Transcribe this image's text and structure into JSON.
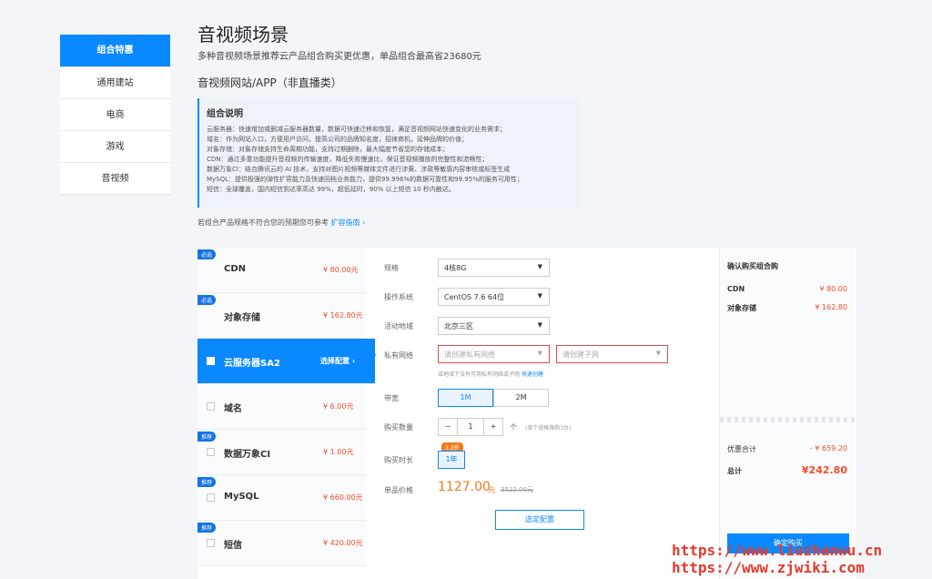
{
  "sidebar": {
    "items": [
      "组合特惠",
      "通用建站",
      "电商",
      "游戏",
      "音视频"
    ]
  },
  "header": {
    "title": "音视频场景",
    "subtitle": "多种音视频场景推荐云产品组合购买更优惠，单品组合最高省23680元",
    "section": "音视频网站/APP（非直播类）"
  },
  "desc": {
    "heading": "组合说明",
    "lines": [
      "云服务器：快速增加或删减云服务器数量，数据可快速迁移和恢复，满足音视频网站快速变化的业务需求；",
      "域名：作为网站入口，方便用户访问，提高公司的品牌知名度，招徕商机，延伸品牌的价值；",
      "对象存储：对象存储支持生命周期功能，支持过期删除，最大幅度节省您的存储成本；",
      "CDN：通过多重功能提升音视频的传输速度，降低失败慢速比，保证音视频播放的完整性和流畅性；",
      "数据万象CI：结合腾讯云的 AI 技术，支持对图片视频等媒体文件进行涉黄、涉政等敏感内容审核或标签生成",
      "MySQL：提供极强的弹性扩容能力及快速回档业务能力，提供99.996%的数据可靠性和99.95%的服务可用性；",
      "短信：全球覆盖，国内短信到达率高达 99%，超低延时，90% 以上短信 10 秒内触达。"
    ]
  },
  "hint": {
    "text": "若组合产品规格不符合您的预期您可参考",
    "link": "扩容指南 ›"
  },
  "products": [
    {
      "tag": "必选",
      "name": "CDN",
      "price": "¥ 80.00元"
    },
    {
      "tag": "必选",
      "name": "对象存储",
      "price": "¥ 162.80元"
    },
    {
      "tag": "",
      "name": "云服务器SA2",
      "select": "选择配置 ›"
    },
    {
      "tag": "",
      "name": "域名",
      "price": "¥ 6.00元"
    },
    {
      "tag": "推荐",
      "name": "数据万象CI",
      "price": "¥ 1.00元"
    },
    {
      "tag": "推荐",
      "name": "MySQL",
      "price": "¥ 660.00元"
    },
    {
      "tag": "推荐",
      "name": "短信",
      "price": "¥ 420.00元"
    }
  ],
  "form": {
    "spec_label": "规格",
    "spec": "4核8G",
    "os_label": "操作系统",
    "os": "CentOS 7.6 64位",
    "region_label": "活动地域",
    "region": "北京三区",
    "net_label": "私有网络",
    "vpc": "请创建私有网络",
    "subnet": "请创建子网",
    "net_note": "该地域下没有可用私有网络或子网",
    "net_link": "快速创建",
    "bw_label": "带宽",
    "bw1": "1M",
    "bw2": "2M",
    "qty_label": "购买数量",
    "qty": "1",
    "qty_unit": "个",
    "qty_note": "(单个规格限购3台)",
    "dur_label": "购买时长",
    "dur_badge": "3.2折",
    "dur": "1年",
    "price_label": "单品价格",
    "price": "1127.00",
    "price_unit": "元",
    "orig": "3522.00元",
    "confirm_btn": "选定配置",
    "minus": "−",
    "plus": "+"
  },
  "cart": {
    "title": "确认购买组合购",
    "items": [
      {
        "name": "CDN",
        "price": "¥ 80.00"
      },
      {
        "name": "对象存储",
        "price": "¥ 162.80"
      }
    ],
    "discount_label": "优惠合计",
    "discount": "- ¥ 659.20",
    "total_label": "总计",
    "total": "¥242.80",
    "buy": "确定购买"
  },
  "watermark": {
    "line1": "https://www.liuzhanwu.cn",
    "line2": "https://www.zjwiki.com"
  }
}
